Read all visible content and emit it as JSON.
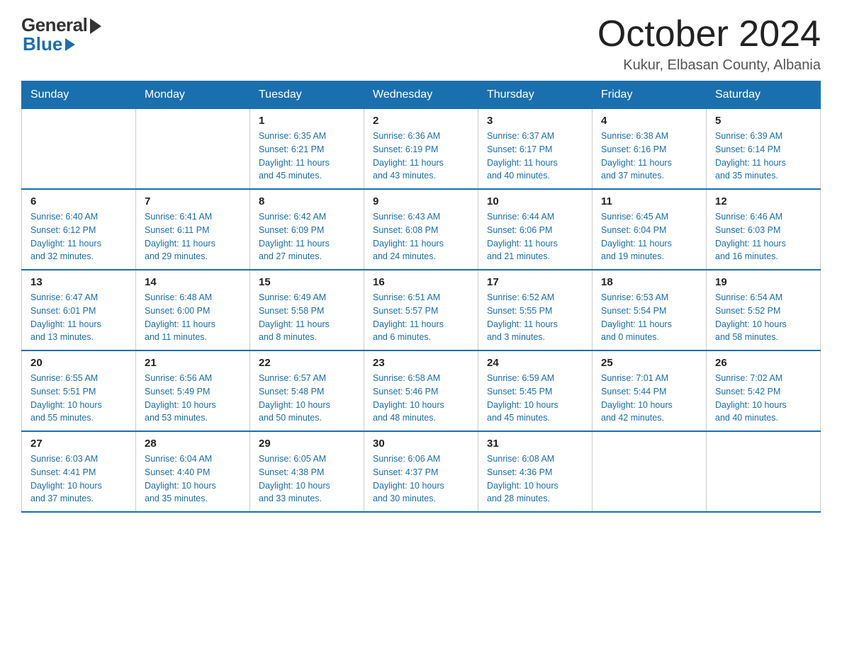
{
  "logo": {
    "general": "General",
    "blue": "Blue"
  },
  "title": {
    "month": "October 2024",
    "location": "Kukur, Elbasan County, Albania"
  },
  "days_header": [
    "Sunday",
    "Monday",
    "Tuesday",
    "Wednesday",
    "Thursday",
    "Friday",
    "Saturday"
  ],
  "weeks": [
    [
      {
        "day": "",
        "info": ""
      },
      {
        "day": "",
        "info": ""
      },
      {
        "day": "1",
        "info": "Sunrise: 6:35 AM\nSunset: 6:21 PM\nDaylight: 11 hours\nand 45 minutes."
      },
      {
        "day": "2",
        "info": "Sunrise: 6:36 AM\nSunset: 6:19 PM\nDaylight: 11 hours\nand 43 minutes."
      },
      {
        "day": "3",
        "info": "Sunrise: 6:37 AM\nSunset: 6:17 PM\nDaylight: 11 hours\nand 40 minutes."
      },
      {
        "day": "4",
        "info": "Sunrise: 6:38 AM\nSunset: 6:16 PM\nDaylight: 11 hours\nand 37 minutes."
      },
      {
        "day": "5",
        "info": "Sunrise: 6:39 AM\nSunset: 6:14 PM\nDaylight: 11 hours\nand 35 minutes."
      }
    ],
    [
      {
        "day": "6",
        "info": "Sunrise: 6:40 AM\nSunset: 6:12 PM\nDaylight: 11 hours\nand 32 minutes."
      },
      {
        "day": "7",
        "info": "Sunrise: 6:41 AM\nSunset: 6:11 PM\nDaylight: 11 hours\nand 29 minutes."
      },
      {
        "day": "8",
        "info": "Sunrise: 6:42 AM\nSunset: 6:09 PM\nDaylight: 11 hours\nand 27 minutes."
      },
      {
        "day": "9",
        "info": "Sunrise: 6:43 AM\nSunset: 6:08 PM\nDaylight: 11 hours\nand 24 minutes."
      },
      {
        "day": "10",
        "info": "Sunrise: 6:44 AM\nSunset: 6:06 PM\nDaylight: 11 hours\nand 21 minutes."
      },
      {
        "day": "11",
        "info": "Sunrise: 6:45 AM\nSunset: 6:04 PM\nDaylight: 11 hours\nand 19 minutes."
      },
      {
        "day": "12",
        "info": "Sunrise: 6:46 AM\nSunset: 6:03 PM\nDaylight: 11 hours\nand 16 minutes."
      }
    ],
    [
      {
        "day": "13",
        "info": "Sunrise: 6:47 AM\nSunset: 6:01 PM\nDaylight: 11 hours\nand 13 minutes."
      },
      {
        "day": "14",
        "info": "Sunrise: 6:48 AM\nSunset: 6:00 PM\nDaylight: 11 hours\nand 11 minutes."
      },
      {
        "day": "15",
        "info": "Sunrise: 6:49 AM\nSunset: 5:58 PM\nDaylight: 11 hours\nand 8 minutes."
      },
      {
        "day": "16",
        "info": "Sunrise: 6:51 AM\nSunset: 5:57 PM\nDaylight: 11 hours\nand 6 minutes."
      },
      {
        "day": "17",
        "info": "Sunrise: 6:52 AM\nSunset: 5:55 PM\nDaylight: 11 hours\nand 3 minutes."
      },
      {
        "day": "18",
        "info": "Sunrise: 6:53 AM\nSunset: 5:54 PM\nDaylight: 11 hours\nand 0 minutes."
      },
      {
        "day": "19",
        "info": "Sunrise: 6:54 AM\nSunset: 5:52 PM\nDaylight: 10 hours\nand 58 minutes."
      }
    ],
    [
      {
        "day": "20",
        "info": "Sunrise: 6:55 AM\nSunset: 5:51 PM\nDaylight: 10 hours\nand 55 minutes."
      },
      {
        "day": "21",
        "info": "Sunrise: 6:56 AM\nSunset: 5:49 PM\nDaylight: 10 hours\nand 53 minutes."
      },
      {
        "day": "22",
        "info": "Sunrise: 6:57 AM\nSunset: 5:48 PM\nDaylight: 10 hours\nand 50 minutes."
      },
      {
        "day": "23",
        "info": "Sunrise: 6:58 AM\nSunset: 5:46 PM\nDaylight: 10 hours\nand 48 minutes."
      },
      {
        "day": "24",
        "info": "Sunrise: 6:59 AM\nSunset: 5:45 PM\nDaylight: 10 hours\nand 45 minutes."
      },
      {
        "day": "25",
        "info": "Sunrise: 7:01 AM\nSunset: 5:44 PM\nDaylight: 10 hours\nand 42 minutes."
      },
      {
        "day": "26",
        "info": "Sunrise: 7:02 AM\nSunset: 5:42 PM\nDaylight: 10 hours\nand 40 minutes."
      }
    ],
    [
      {
        "day": "27",
        "info": "Sunrise: 6:03 AM\nSunset: 4:41 PM\nDaylight: 10 hours\nand 37 minutes."
      },
      {
        "day": "28",
        "info": "Sunrise: 6:04 AM\nSunset: 4:40 PM\nDaylight: 10 hours\nand 35 minutes."
      },
      {
        "day": "29",
        "info": "Sunrise: 6:05 AM\nSunset: 4:38 PM\nDaylight: 10 hours\nand 33 minutes."
      },
      {
        "day": "30",
        "info": "Sunrise: 6:06 AM\nSunset: 4:37 PM\nDaylight: 10 hours\nand 30 minutes."
      },
      {
        "day": "31",
        "info": "Sunrise: 6:08 AM\nSunset: 4:36 PM\nDaylight: 10 hours\nand 28 minutes."
      },
      {
        "day": "",
        "info": ""
      },
      {
        "day": "",
        "info": ""
      }
    ]
  ]
}
